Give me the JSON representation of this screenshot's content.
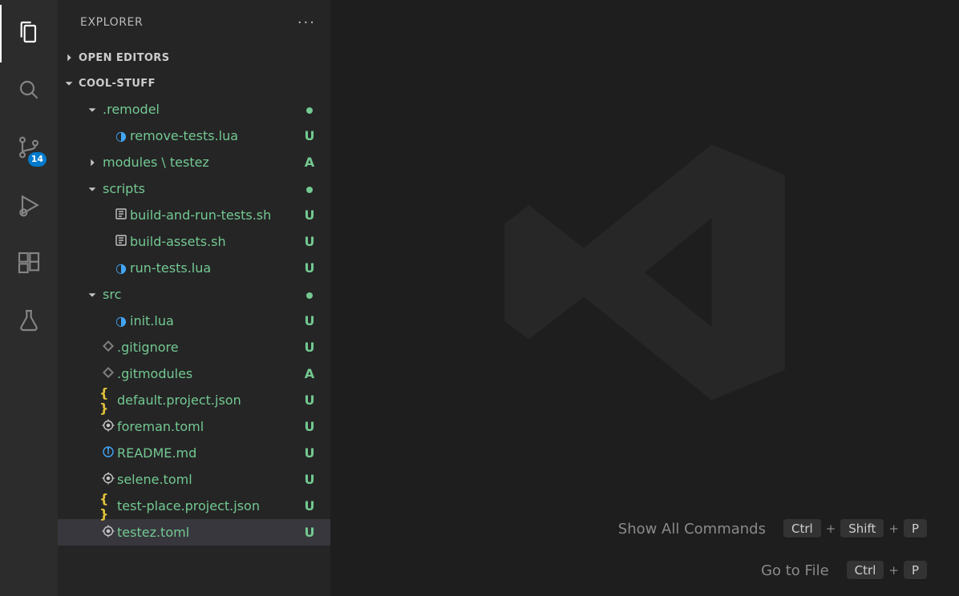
{
  "activitybar": {
    "scm_badge": "14"
  },
  "sidebar": {
    "title": "EXPLORER",
    "sections": {
      "open_editors": "OPEN EDITORS",
      "folder": "COOL-STUFF"
    }
  },
  "tree": [
    {
      "depth": 1,
      "kind": "folder-open",
      "name": ".remodel",
      "deco": "dot",
      "clr": "u"
    },
    {
      "depth": 2,
      "kind": "lua",
      "name": "remove-tests.lua",
      "deco": "U",
      "clr": "u"
    },
    {
      "depth": 1,
      "kind": "folder-closed",
      "name": "modules \\ testez",
      "deco": "A",
      "clr": "a"
    },
    {
      "depth": 1,
      "kind": "folder-open",
      "name": "scripts",
      "deco": "dot",
      "clr": "u"
    },
    {
      "depth": 2,
      "kind": "sh",
      "name": "build-and-run-tests.sh",
      "deco": "U",
      "clr": "u"
    },
    {
      "depth": 2,
      "kind": "sh",
      "name": "build-assets.sh",
      "deco": "U",
      "clr": "u"
    },
    {
      "depth": 2,
      "kind": "lua",
      "name": "run-tests.lua",
      "deco": "U",
      "clr": "u"
    },
    {
      "depth": 1,
      "kind": "folder-open",
      "name": "src",
      "deco": "dot",
      "clr": "u"
    },
    {
      "depth": 2,
      "kind": "lua",
      "name": "init.lua",
      "deco": "U",
      "clr": "u"
    },
    {
      "depth": 1,
      "kind": "git",
      "name": ".gitignore",
      "deco": "U",
      "clr": "u"
    },
    {
      "depth": 1,
      "kind": "git",
      "name": ".gitmodules",
      "deco": "A",
      "clr": "a"
    },
    {
      "depth": 1,
      "kind": "json",
      "name": "default.project.json",
      "deco": "U",
      "clr": "u"
    },
    {
      "depth": 1,
      "kind": "toml",
      "name": "foreman.toml",
      "deco": "U",
      "clr": "u"
    },
    {
      "depth": 1,
      "kind": "md",
      "name": "README.md",
      "deco": "U",
      "clr": "u"
    },
    {
      "depth": 1,
      "kind": "toml",
      "name": "selene.toml",
      "deco": "U",
      "clr": "u"
    },
    {
      "depth": 1,
      "kind": "json",
      "name": "test-place.project.json",
      "deco": "U",
      "clr": "u"
    },
    {
      "depth": 1,
      "kind": "toml",
      "name": "testez.toml",
      "deco": "U",
      "clr": "u",
      "selected": true
    }
  ],
  "hints": [
    {
      "label": "Show All Commands",
      "keys": [
        "Ctrl",
        "Shift",
        "P"
      ]
    },
    {
      "label": "Go to File",
      "keys": [
        "Ctrl",
        "P"
      ]
    }
  ]
}
